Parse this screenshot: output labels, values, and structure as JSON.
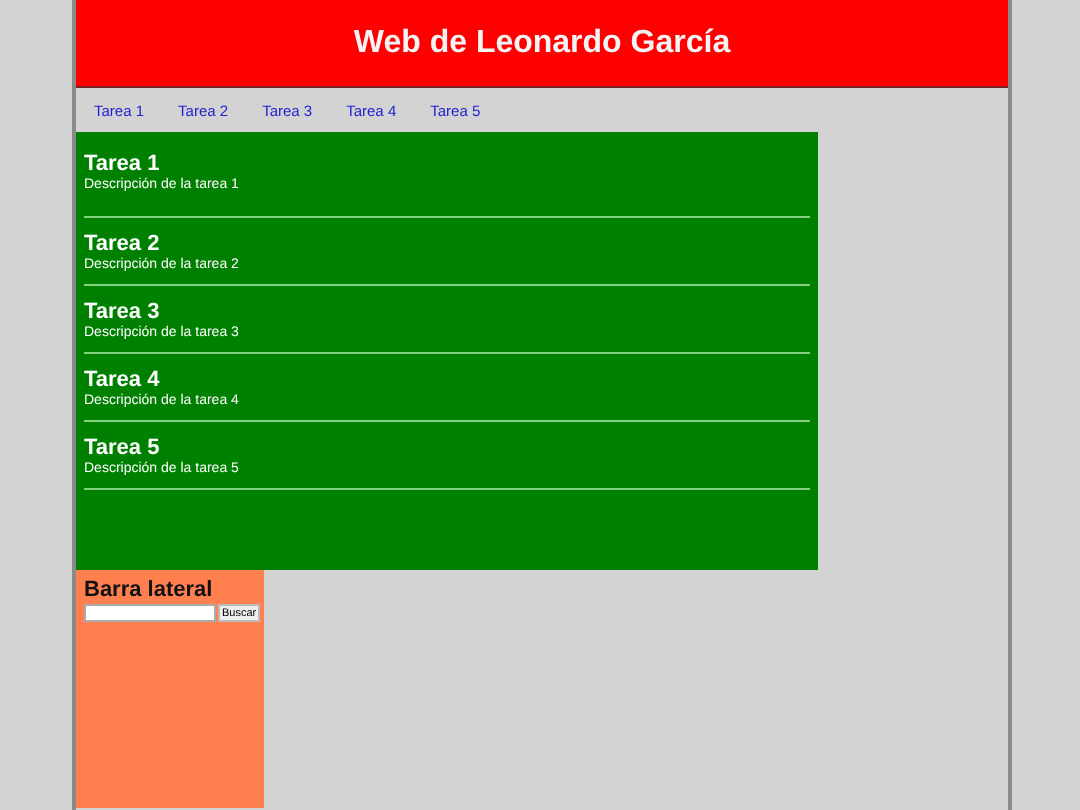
{
  "header": {
    "title": "Web de Leonardo García"
  },
  "nav": [
    {
      "label": "Tarea 1"
    },
    {
      "label": "Tarea 2"
    },
    {
      "label": "Tarea 3"
    },
    {
      "label": "Tarea 4"
    },
    {
      "label": "Tarea 5"
    }
  ],
  "tasks": [
    {
      "title": "Tarea 1",
      "description": "Descripción de la tarea 1"
    },
    {
      "title": "Tarea 2",
      "description": "Descripción de la tarea 2"
    },
    {
      "title": "Tarea 3",
      "description": "Descripción de la tarea 3"
    },
    {
      "title": "Tarea 4",
      "description": "Descripción de la tarea 4"
    },
    {
      "title": "Tarea 5",
      "description": "Descripción de la tarea 5"
    }
  ],
  "sidebar": {
    "title": "Barra lateral",
    "search_button": "Buscar"
  }
}
